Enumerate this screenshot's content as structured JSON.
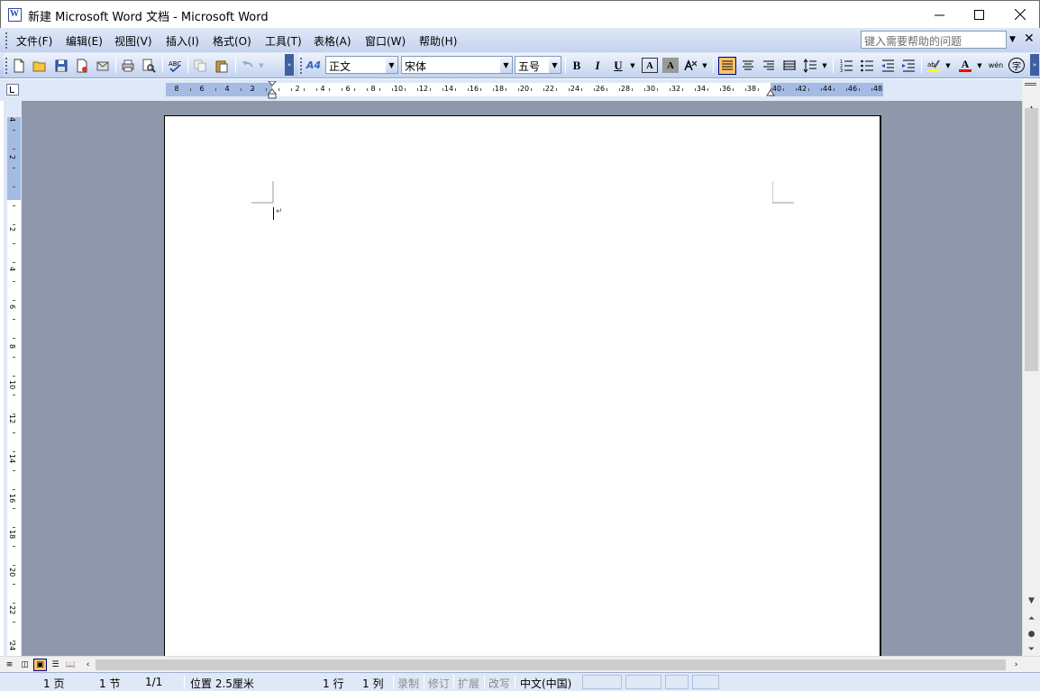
{
  "window": {
    "title": "新建 Microsoft Word 文档 - Microsoft Word",
    "minimize_label": "—",
    "maximize_label": "☐",
    "close_label": "✕"
  },
  "menu": {
    "items": [
      "文件(F)",
      "编辑(E)",
      "视图(V)",
      "插入(I)",
      "格式(O)",
      "工具(T)",
      "表格(A)",
      "窗口(W)",
      "帮助(H)"
    ],
    "help_placeholder": "键入需要帮助的问题",
    "close_doc": "✕"
  },
  "toolbar": {
    "style": "正文",
    "font": "宋体",
    "size": "五号",
    "style_icon": "A4",
    "bold": "B",
    "italic": "I",
    "underline": "U",
    "border_char": "A",
    "shading_char": "A",
    "font_color_char": "A",
    "wen_char": "wén",
    "circle_char": "字",
    "accent_highlight": "#ffff00",
    "accent_font_color": "#ff0000"
  },
  "ruler": {
    "left_numbers": [
      "8",
      "6",
      "4",
      "2"
    ],
    "right_numbers": [
      "2",
      "4",
      "6",
      "8",
      "10",
      "12",
      "14",
      "16",
      "18",
      "20",
      "22",
      "24",
      "26",
      "28",
      "30",
      "32",
      "34",
      "36",
      "38",
      "40",
      "42",
      "44",
      "46",
      "48"
    ],
    "vertical_numbers": [
      "4",
      "2",
      "2",
      "4",
      "6",
      "8",
      "10",
      "12",
      "14",
      "16",
      "18",
      "20",
      "22",
      "24"
    ]
  },
  "document": {
    "paragraph_mark": "↵"
  },
  "status": {
    "page": "1 页",
    "section": "1 节",
    "page_of": "1/1",
    "position": "位置 2.5厘米",
    "line": "1 行",
    "column": "1 列",
    "rec": "录制",
    "trk": "修订",
    "ext": "扩展",
    "ovr": "改写",
    "language": "中文(中国)"
  }
}
